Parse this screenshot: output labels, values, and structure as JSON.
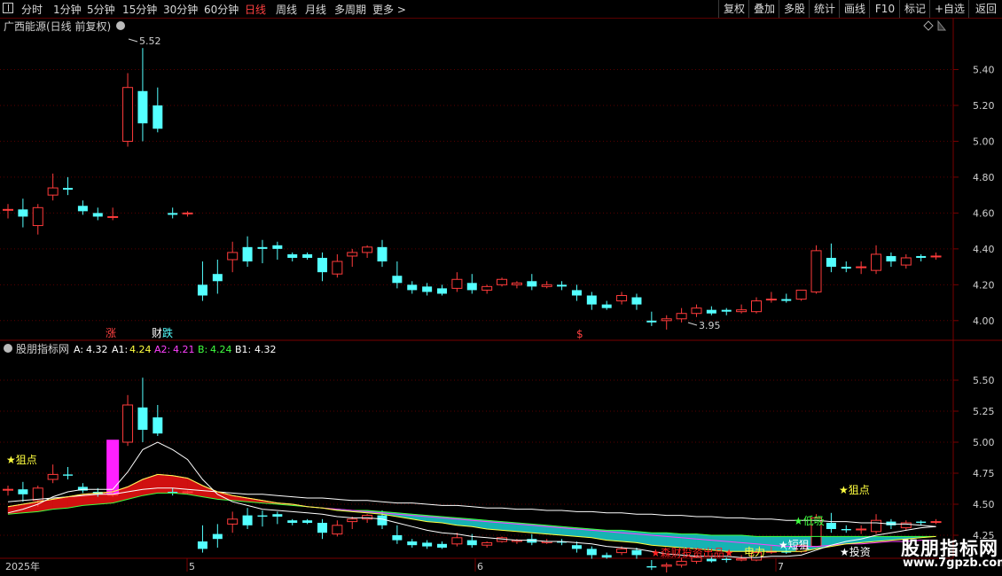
{
  "toolbar": {
    "left_icon": "panel-toggle-icon",
    "periods": [
      "分时",
      "1分钟",
      "5分钟",
      "15分钟",
      "30分钟",
      "60分钟",
      "日线",
      "周线",
      "月线",
      "多周期",
      "更多 >"
    ],
    "active_period": "日线",
    "right": [
      "复权",
      "叠加",
      "多股",
      "统计",
      "画线",
      "F10",
      "标记",
      "+自选",
      "返回"
    ]
  },
  "main_panel": {
    "title": "广西能源(日线 前复权)",
    "y_ticks": [
      "5.40",
      "5.20",
      "5.00",
      "4.80",
      "4.60",
      "4.40",
      "4.20",
      "4.00"
    ],
    "high_label": "5.52",
    "low_label": "3.95",
    "event_marks": [
      "涨",
      "财",
      "跌",
      "$"
    ]
  },
  "indicator_panel": {
    "title": "股朋指标网",
    "A_label": "A:",
    "A_value": "4.32",
    "A1_label": "A1:",
    "A1_value": "4.24",
    "A2_label": "A2:",
    "A2_value": "4.21",
    "B_label": "B:",
    "B_value": "4.24",
    "B1_label": "B1:",
    "B1_value": "4.32",
    "y_ticks": [
      "5.50",
      "5.25",
      "5.00",
      "4.75",
      "4.50",
      "4.25"
    ],
    "signals": [
      "★狙点",
      "★狙点",
      "★低吸",
      "★短狙",
      "★投资",
      "★森财投资出品★",
      "电力"
    ]
  },
  "time_axis": [
    "2025年",
    "5",
    "6",
    "7"
  ],
  "watermark": {
    "title": "股朋指标网",
    "url": "www.7gpzb.com"
  },
  "colors": {
    "up": "#ff3b3b",
    "down": "#54ffff",
    "A": "#ffffff",
    "A1": "#ffff40",
    "A2": "#ff40ff",
    "B": "#40ff40",
    "B1": "#ffffff"
  },
  "chart_data": {
    "type": "candlestick",
    "title": "广西能源(日线 前复权)",
    "x": [
      "2025-04-07",
      "2025-04-08",
      "2025-04-09",
      "2025-04-10",
      "2025-04-11",
      "2025-04-14",
      "2025-04-15",
      "2025-04-16",
      "2025-04-17",
      "2025-04-18",
      "2025-04-21",
      "2025-04-22",
      "2025-04-23",
      "2025-04-24",
      "2025-04-25",
      "2025-04-28",
      "2025-04-29",
      "2025-04-30",
      "2025-05-06",
      "2025-05-07",
      "2025-05-08",
      "2025-05-09",
      "2025-05-12",
      "2025-05-13",
      "2025-05-14",
      "2025-05-15",
      "2025-05-16",
      "2025-05-19",
      "2025-05-20",
      "2025-05-21",
      "2025-05-22",
      "2025-05-23",
      "2025-05-26",
      "2025-05-27",
      "2025-05-28",
      "2025-05-29",
      "2025-05-30",
      "2025-06-03",
      "2025-06-04",
      "2025-06-05",
      "2025-06-06",
      "2025-06-09",
      "2025-06-10",
      "2025-06-11",
      "2025-06-12",
      "2025-06-13",
      "2025-06-16",
      "2025-06-17",
      "2025-06-18",
      "2025-06-19",
      "2025-06-20",
      "2025-06-23",
      "2025-06-24",
      "2025-06-25",
      "2025-06-26",
      "2025-06-27",
      "2025-06-30",
      "2025-07-01",
      "2025-07-02",
      "2025-07-03",
      "2025-07-04",
      "2025-07-07",
      "2025-07-08"
    ],
    "open": [
      4.62,
      4.62,
      4.53,
      4.7,
      4.74,
      4.64,
      4.6,
      4.58,
      5.0,
      5.28,
      5.2,
      4.6,
      4.6,
      4.2,
      4.26,
      4.34,
      4.41,
      4.41,
      4.42,
      4.37,
      4.37,
      4.35,
      4.26,
      4.36,
      4.38,
      4.41,
      4.25,
      4.2,
      4.19,
      4.18,
      4.18,
      4.21,
      4.17,
      4.2,
      4.2,
      4.22,
      4.19,
      4.2,
      4.17,
      4.14,
      4.09,
      4.11,
      4.13,
      4.0,
      4.0,
      4.01,
      4.04,
      4.06,
      4.06,
      4.05,
      4.05,
      4.12,
      4.12,
      4.12,
      4.16,
      4.35,
      4.3,
      4.3,
      4.28,
      4.36,
      4.31,
      4.36,
      4.36
    ],
    "close": [
      4.62,
      4.58,
      4.63,
      4.74,
      4.73,
      4.61,
      4.58,
      4.58,
      5.3,
      5.1,
      5.07,
      4.59,
      4.6,
      4.14,
      4.22,
      4.38,
      4.33,
      4.4,
      4.4,
      4.35,
      4.35,
      4.27,
      4.33,
      4.38,
      4.41,
      4.33,
      4.21,
      4.17,
      4.16,
      4.15,
      4.23,
      4.17,
      4.19,
      4.23,
      4.21,
      4.19,
      4.2,
      4.19,
      4.14,
      4.09,
      4.07,
      4.14,
      4.09,
      3.99,
      4.01,
      4.04,
      4.07,
      4.04,
      4.05,
      4.06,
      4.11,
      4.12,
      4.11,
      4.17,
      4.39,
      4.3,
      4.29,
      4.3,
      4.37,
      4.33,
      4.35,
      4.35,
      4.36
    ],
    "high": [
      4.65,
      4.68,
      4.65,
      4.82,
      4.8,
      4.67,
      4.63,
      4.63,
      5.38,
      5.52,
      5.3,
      4.63,
      4.61,
      4.33,
      4.34,
      4.44,
      4.47,
      4.45,
      4.44,
      4.38,
      4.38,
      4.38,
      4.37,
      4.4,
      4.42,
      4.45,
      4.33,
      4.22,
      4.21,
      4.2,
      4.27,
      4.26,
      4.2,
      4.24,
      4.22,
      4.26,
      4.22,
      4.22,
      4.2,
      4.16,
      4.11,
      4.16,
      4.15,
      4.05,
      4.03,
      4.07,
      4.09,
      4.08,
      4.07,
      4.09,
      4.13,
      4.16,
      4.15,
      4.17,
      4.42,
      4.43,
      4.33,
      4.33,
      4.42,
      4.38,
      4.37,
      4.37,
      4.38
    ],
    "low": [
      4.57,
      4.52,
      4.48,
      4.67,
      4.7,
      4.59,
      4.56,
      4.56,
      4.97,
      5.0,
      5.05,
      4.57,
      4.58,
      4.11,
      4.15,
      4.27,
      4.3,
      4.32,
      4.34,
      4.33,
      4.34,
      4.22,
      4.24,
      4.3,
      4.35,
      4.3,
      4.18,
      4.15,
      4.14,
      4.14,
      4.16,
      4.15,
      4.15,
      4.19,
      4.18,
      4.17,
      4.18,
      4.17,
      4.11,
      4.06,
      4.06,
      4.09,
      4.06,
      3.97,
      3.95,
      3.99,
      4.02,
      4.03,
      4.03,
      4.04,
      4.04,
      4.1,
      4.1,
      4.11,
      4.15,
      4.27,
      4.27,
      4.26,
      4.26,
      4.3,
      4.29,
      4.33,
      4.34
    ],
    "ylim": [
      3.92,
      5.6
    ],
    "high_point": 5.52,
    "low_point": 3.95,
    "indicator": {
      "ylim": [
        4.1,
        5.65
      ],
      "A": [
        4.43,
        4.46,
        4.5,
        4.56,
        4.6,
        4.62,
        4.62,
        4.62,
        4.76,
        4.94,
        5.0,
        4.94,
        4.86,
        4.7,
        4.58,
        4.52,
        4.49,
        4.46,
        4.45,
        4.44,
        4.43,
        4.42,
        4.4,
        4.39,
        4.39,
        4.38,
        4.35,
        4.32,
        4.29,
        4.27,
        4.26,
        4.24,
        4.23,
        4.22,
        4.21,
        4.21,
        4.2,
        4.2,
        4.19,
        4.18,
        4.16,
        4.15,
        4.14,
        4.12,
        4.1,
        4.09,
        4.08,
        4.08,
        4.08,
        4.07,
        4.07,
        4.08,
        4.08,
        4.09,
        4.13,
        4.17,
        4.2,
        4.22,
        4.25,
        4.27,
        4.29,
        4.31,
        4.32
      ],
      "A1": [
        4.48,
        4.5,
        4.52,
        4.54,
        4.56,
        4.58,
        4.59,
        4.6,
        4.64,
        4.7,
        4.74,
        4.73,
        4.71,
        4.65,
        4.6,
        4.57,
        4.55,
        4.53,
        4.51,
        4.5,
        4.48,
        4.47,
        4.45,
        4.44,
        4.43,
        4.42,
        4.4,
        4.38,
        4.36,
        4.35,
        4.33,
        4.32,
        4.3,
        4.29,
        4.28,
        4.27,
        4.26,
        4.25,
        4.24,
        4.23,
        4.21,
        4.2,
        4.19,
        4.17,
        4.16,
        4.15,
        4.14,
        4.13,
        4.12,
        4.12,
        4.12,
        4.12,
        4.12,
        4.12,
        4.14,
        4.16,
        4.18,
        4.19,
        4.2,
        4.21,
        4.22,
        4.23,
        4.24
      ],
      "A2": [
        4.48,
        4.5,
        4.52,
        4.54,
        4.56,
        4.58,
        4.59,
        4.6,
        4.64,
        4.7,
        4.74,
        4.73,
        4.71,
        4.65,
        4.6,
        4.57,
        4.55,
        4.53,
        4.51,
        4.5,
        4.48,
        4.47,
        4.46,
        4.45,
        4.44,
        4.43,
        4.42,
        4.41,
        4.4,
        4.39,
        4.38,
        4.37,
        4.36,
        4.35,
        4.34,
        4.33,
        4.32,
        4.31,
        4.3,
        4.29,
        4.28,
        4.27,
        4.26,
        4.25,
        4.24,
        4.23,
        4.22,
        4.21,
        4.2,
        4.19,
        4.18,
        4.17,
        4.16,
        4.16,
        4.16,
        4.17,
        4.18,
        4.18,
        4.19,
        4.2,
        4.2,
        4.21,
        4.21
      ],
      "B": [
        4.42,
        4.43,
        4.44,
        4.46,
        4.47,
        4.49,
        4.5,
        4.51,
        4.54,
        4.57,
        4.59,
        4.59,
        4.58,
        4.56,
        4.54,
        4.53,
        4.52,
        4.51,
        4.5,
        4.49,
        4.48,
        4.47,
        4.46,
        4.45,
        4.45,
        4.44,
        4.43,
        4.42,
        4.41,
        4.4,
        4.39,
        4.38,
        4.37,
        4.36,
        4.35,
        4.34,
        4.33,
        4.32,
        4.31,
        4.3,
        4.29,
        4.29,
        4.28,
        4.27,
        4.27,
        4.26,
        4.26,
        4.25,
        4.25,
        4.25,
        4.24,
        4.24,
        4.24,
        4.24,
        4.24,
        4.24,
        4.24,
        4.24,
        4.24,
        4.24,
        4.24,
        4.24,
        4.24
      ],
      "B1": [
        4.52,
        4.53,
        4.54,
        4.55,
        4.56,
        4.57,
        4.58,
        4.58,
        4.6,
        4.62,
        4.63,
        4.63,
        4.62,
        4.61,
        4.6,
        4.59,
        4.58,
        4.58,
        4.57,
        4.56,
        4.55,
        4.55,
        4.54,
        4.53,
        4.53,
        4.52,
        4.51,
        4.51,
        4.5,
        4.49,
        4.49,
        4.48,
        4.47,
        4.47,
        4.46,
        4.46,
        4.45,
        4.45,
        4.44,
        4.44,
        4.43,
        4.43,
        4.42,
        4.42,
        4.41,
        4.41,
        4.4,
        4.4,
        4.39,
        4.39,
        4.38,
        4.38,
        4.37,
        4.37,
        4.37,
        4.36,
        4.36,
        4.35,
        4.35,
        4.34,
        4.34,
        4.33,
        4.32
      ]
    }
  }
}
